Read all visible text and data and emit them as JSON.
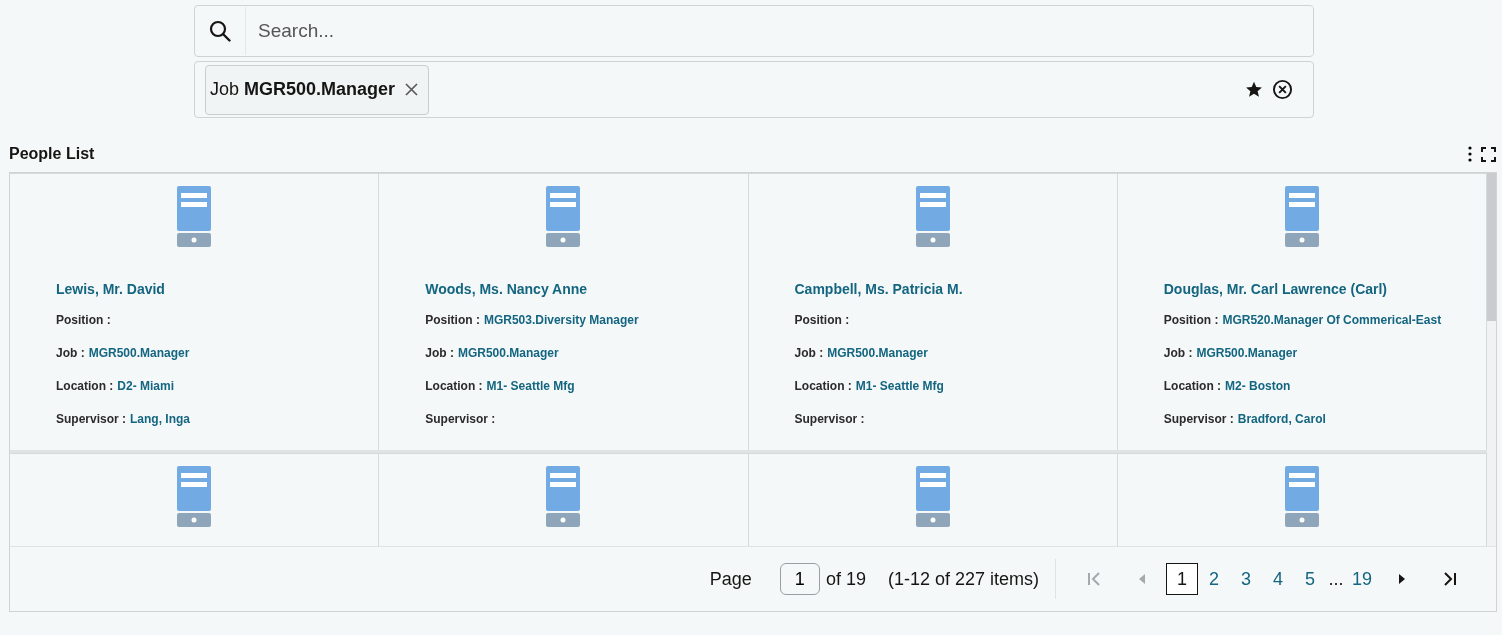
{
  "search": {
    "placeholder": "Search..."
  },
  "filters": [
    {
      "text": "Job **MGR500.Manager**"
    }
  ],
  "section": {
    "title": "People List"
  },
  "cards": [
    {
      "kind": "full",
      "name": "Lewis, Mr. David",
      "fields": [
        {
          "label": "Position :"
        },
        {
          "label": "Job :",
          "value": "MGR500.Manager"
        },
        {
          "label": "Location :",
          "value": "D2- Miami"
        },
        {
          "label": "Supervisor :",
          "value": "Lang, Inga"
        }
      ]
    },
    {
      "kind": "full",
      "name": "Woods, Ms. Nancy Anne",
      "fields": [
        {
          "label": "Position :",
          "value": "MGR503.Diversity Manager"
        },
        {
          "label": "Job :",
          "value": "MGR500.Manager"
        },
        {
          "label": "Location :",
          "value": "M1- Seattle Mfg"
        },
        {
          "label": "Supervisor :"
        }
      ]
    },
    {
      "kind": "full",
      "name": "Campbell, Ms. Patricia M.",
      "fields": [
        {
          "label": "Position :"
        },
        {
          "label": "Job :",
          "value": "MGR500.Manager"
        },
        {
          "label": "Location :",
          "value": "M1- Seattle Mfg"
        },
        {
          "label": "Supervisor :"
        }
      ]
    },
    {
      "kind": "full",
      "name": "Douglas, Mr. Carl Lawrence (Carl)",
      "fields": [
        {
          "label": "Position :",
          "value": "MGR520.Manager Of Commerical-East"
        },
        {
          "label": "Job :",
          "value": "MGR500.Manager"
        },
        {
          "label": "Location :",
          "value": "M2- Boston"
        },
        {
          "label": "Supervisor :",
          "value": "Bradford, Carol"
        }
      ]
    },
    {
      "kind": "icon-only"
    },
    {
      "kind": "icon-only"
    },
    {
      "kind": "icon-only"
    },
    {
      "kind": "icon-only"
    }
  ],
  "pagination": {
    "page_label": "Page",
    "page_value": "1",
    "of_label": "of 19",
    "range": "(1-12 of 227 items)",
    "first": {
      "disabled": true
    },
    "prev": {
      "disabled": true
    },
    "pages": [
      {
        "label": "1",
        "selected": true
      },
      {
        "label": "2",
        "selected": false
      },
      {
        "label": "3",
        "selected": false
      },
      {
        "label": "4",
        "selected": false
      },
      {
        "label": "5",
        "selected": false
      }
    ],
    "ellipsis": "...",
    "last_page": {
      "label": "19",
      "selected": false
    },
    "next": {
      "disabled": false
    },
    "last": {
      "disabled": false
    }
  }
}
